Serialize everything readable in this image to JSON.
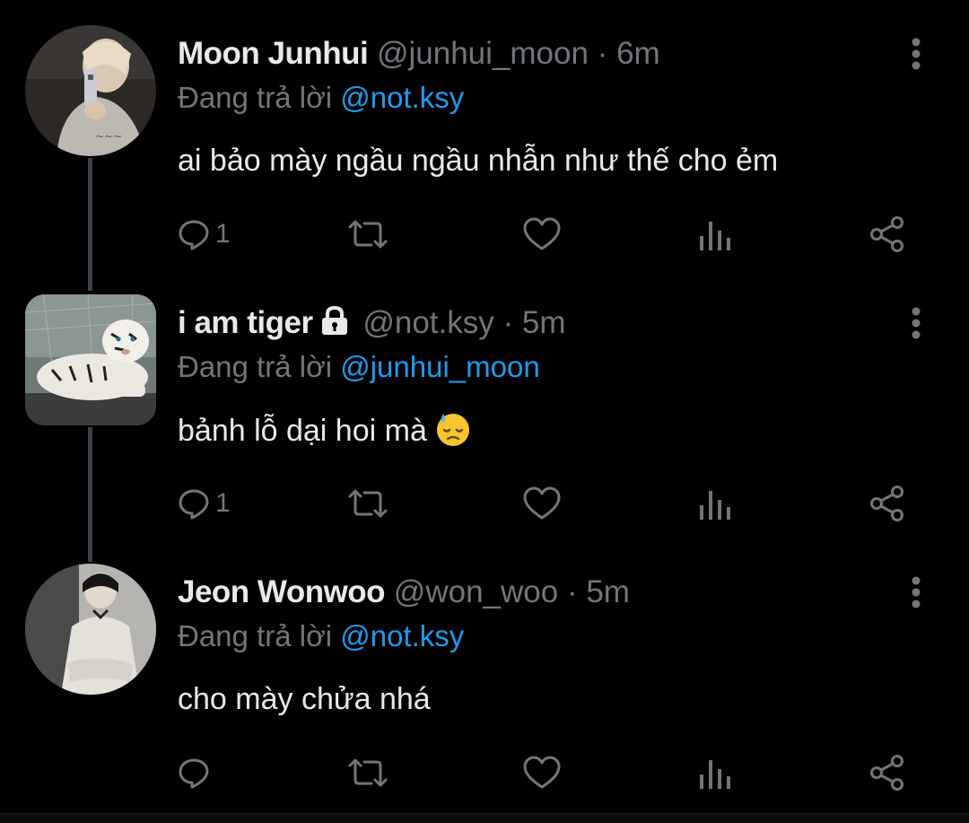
{
  "tweets": [
    {
      "name": "Moon Junhui",
      "handle": "@junhui_moon",
      "separator": "·",
      "time": "6m",
      "reply_prefix": "Đang trả lời",
      "reply_to": "@not.ksy",
      "text": "ai bảo mày ngầu ngầu nhẫn như thế cho ẻm",
      "reply_count": "1",
      "locked": false,
      "avatar": "avatar-photo-mirror-selfie"
    },
    {
      "name": "i am tiger",
      "handle": "@not.ksy",
      "separator": "·",
      "time": "5m",
      "reply_prefix": "Đang trả lời",
      "reply_to": "@junhui_moon",
      "text": "bảnh lỗ dại hoi mà",
      "reply_count": "1",
      "locked": true,
      "emoji": "downcast-face-with-sweat",
      "avatar": "avatar-photo-white-tiger"
    },
    {
      "name": "Jeon Wonwoo",
      "handle": "@won_woo",
      "separator": "·",
      "time": "5m",
      "reply_prefix": "Đang trả lời",
      "reply_to": "@not.ksy",
      "text": "cho mày chửa nhá",
      "reply_count": "",
      "locked": false,
      "avatar": "avatar-photo-person-sitting"
    }
  ],
  "icons": {
    "reply": "reply-icon",
    "retweet": "retweet-icon",
    "like": "like-icon",
    "views": "views-icon",
    "share": "share-icon",
    "more": "more-icon",
    "lock": "lock-icon"
  },
  "colors": {
    "background": "#000000",
    "text": "#e7e9ea",
    "secondary": "#71767b",
    "link": "#1d9bf0",
    "thread_line": "#3c4249"
  }
}
